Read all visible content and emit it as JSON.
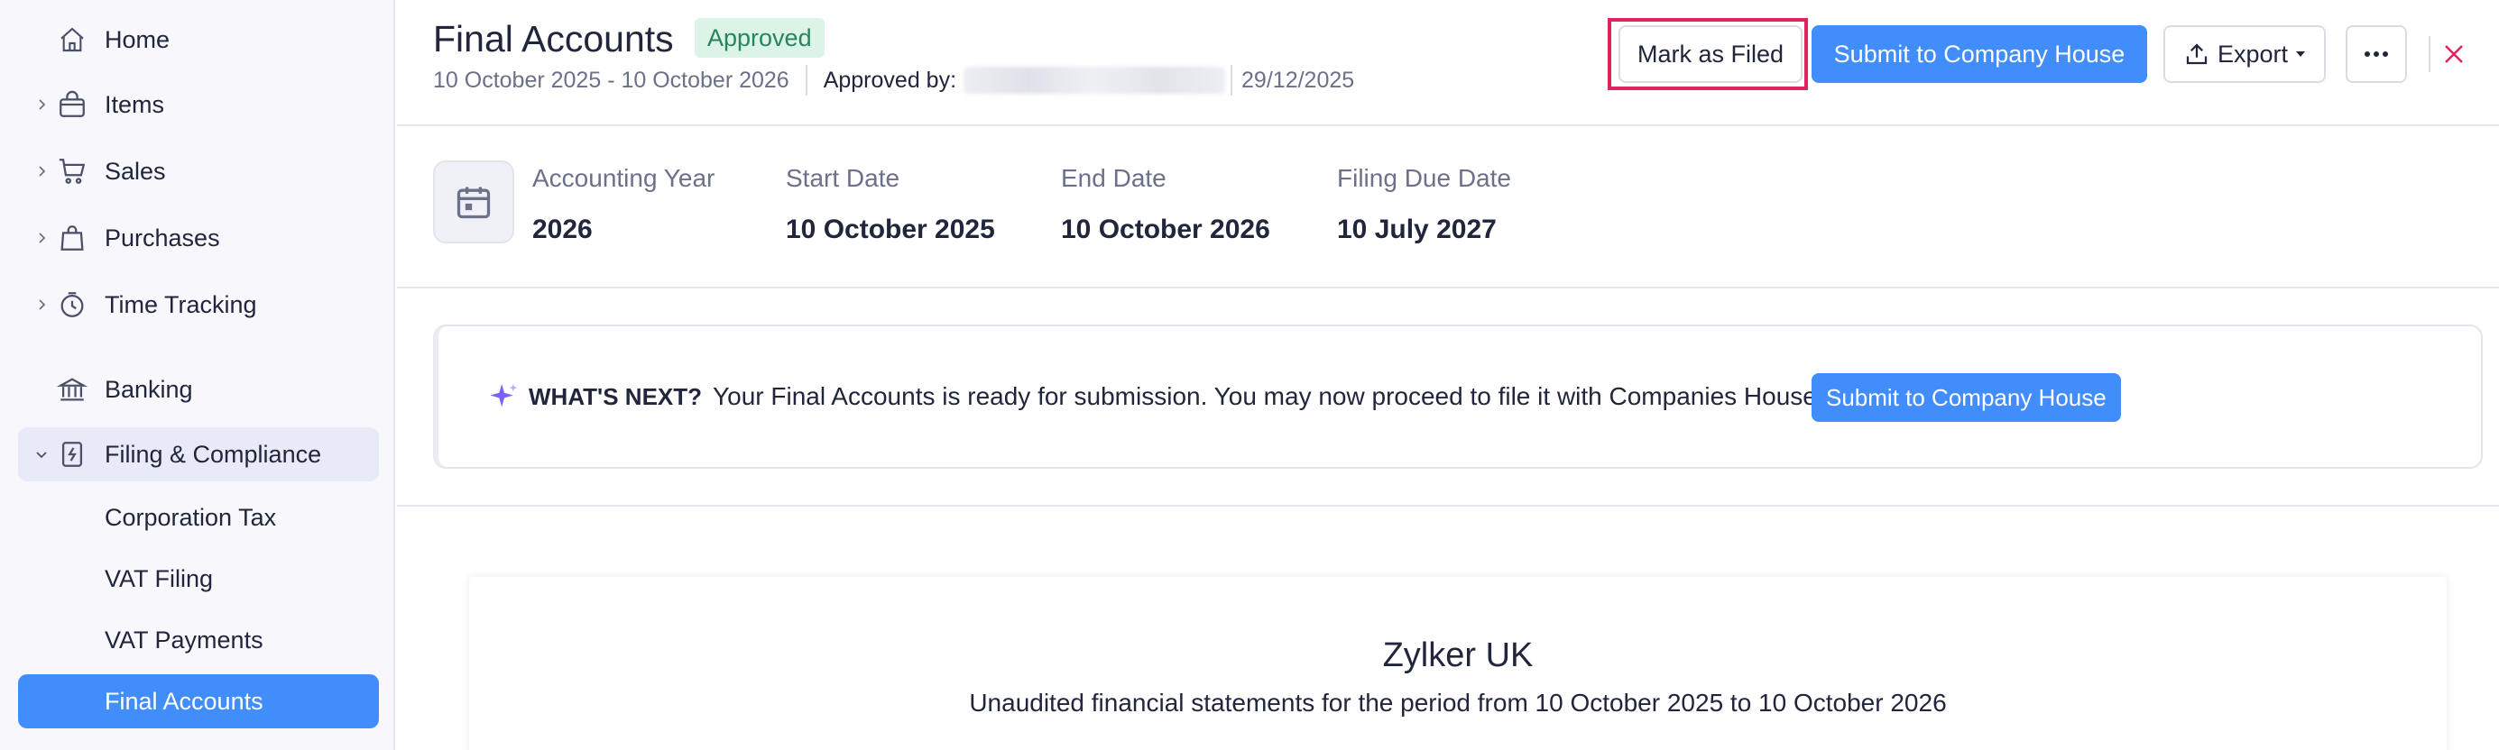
{
  "sidebar": {
    "items": [
      {
        "label": "Home",
        "icon": "home-icon"
      },
      {
        "label": "Items",
        "icon": "basket-icon"
      },
      {
        "label": "Sales",
        "icon": "cart-icon"
      },
      {
        "label": "Purchases",
        "icon": "bag-icon"
      },
      {
        "label": "Time Tracking",
        "icon": "timer-icon"
      },
      {
        "label": "Banking",
        "icon": "bank-icon"
      },
      {
        "label": "Filing & Compliance",
        "icon": "compliance-icon"
      }
    ],
    "subitems": [
      {
        "label": "Corporation Tax"
      },
      {
        "label": "VAT Filing"
      },
      {
        "label": "VAT Payments"
      },
      {
        "label": "Final Accounts"
      }
    ]
  },
  "header": {
    "title": "Final Accounts",
    "badge": "Approved",
    "period": "10 October 2025 - 10 October 2026",
    "approved_by_label": "Approved by:",
    "approved_date": "29/12/2025",
    "mark_filed": "Mark as Filed",
    "submit": "Submit to Company House",
    "export": "Export",
    "more_icon": "ellipsis-icon",
    "close_icon": "close-icon"
  },
  "info": [
    {
      "label": "Accounting Year",
      "value": "2026"
    },
    {
      "label": "Start Date",
      "value": "10 October 2025"
    },
    {
      "label": "End Date",
      "value": "10 October 2026"
    },
    {
      "label": "Filing Due Date",
      "value": "10 July 2027"
    }
  ],
  "next": {
    "label": "WHAT'S NEXT?",
    "message": "Your Final Accounts is ready for submission. You may now proceed to file it with Companies House.",
    "button": "Submit to Company House"
  },
  "statement": {
    "company": "Zylker UK",
    "period_text": "Unaudited financial statements for the period from 10 October 2025 to 10 October 2026"
  },
  "colors": {
    "accent": "#408dfb",
    "badge_bg": "#dcf3e8",
    "badge_text": "#26855a",
    "highlight": "#e0245e",
    "close": "#e0245e"
  }
}
